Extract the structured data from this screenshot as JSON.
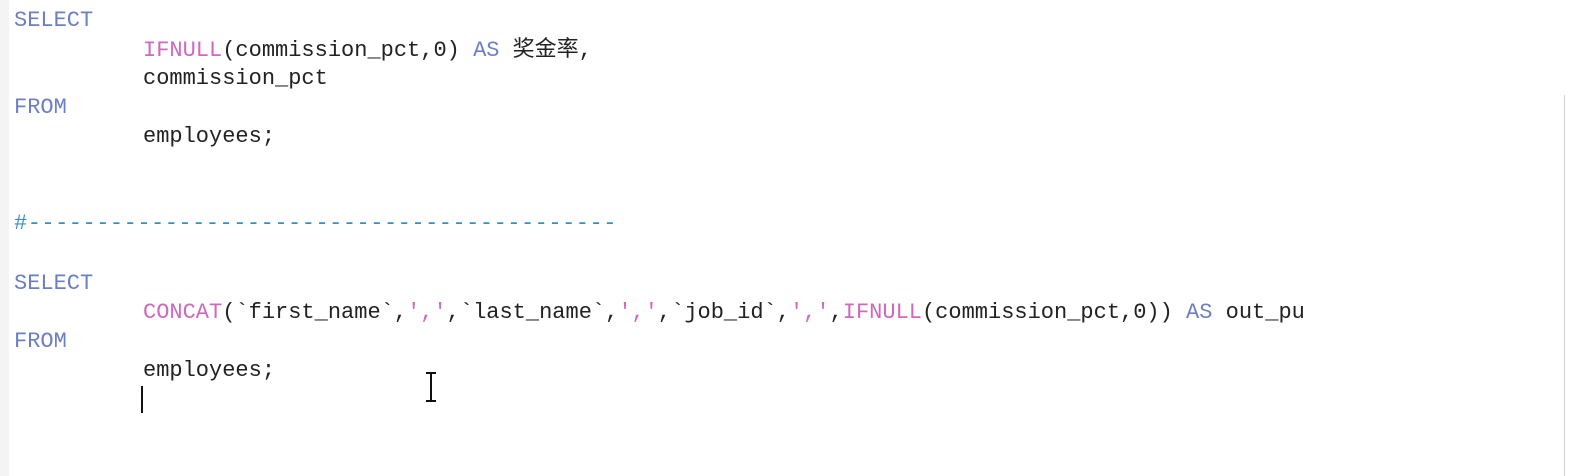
{
  "editor": {
    "lines": [
      {
        "tokens": [
          {
            "t": "SELECT",
            "c": "kw"
          }
        ]
      },
      {
        "indent": true,
        "tokens": [
          {
            "t": "IFNULL",
            "c": "fn"
          },
          {
            "t": "(commission_pct,0) ",
            "c": "id"
          },
          {
            "t": "AS",
            "c": "kw"
          },
          {
            "t": " ",
            "c": "id"
          },
          {
            "t": "奖金率",
            "c": "id cjk"
          },
          {
            "t": ",",
            "c": "id"
          }
        ]
      },
      {
        "indent": true,
        "tokens": [
          {
            "t": "commission_pct",
            "c": "id"
          }
        ]
      },
      {
        "tokens": [
          {
            "t": "FROM",
            "c": "kw"
          }
        ]
      },
      {
        "indent": true,
        "tokens": [
          {
            "t": "employees;",
            "c": "id"
          }
        ]
      },
      {
        "tokens": []
      },
      {
        "tokens": []
      },
      {
        "tokens": [
          {
            "t": "#-------------------------------------------",
            "c": "cm"
          }
        ]
      },
      {
        "tokens": []
      },
      {
        "tokens": [
          {
            "t": "SELECT",
            "c": "kw"
          }
        ]
      },
      {
        "indent": true,
        "tokens": [
          {
            "t": "CONCAT",
            "c": "fn"
          },
          {
            "t": "(`first_name`,",
            "c": "id"
          },
          {
            "t": "','",
            "c": "str"
          },
          {
            "t": ",`last_name`,",
            "c": "id"
          },
          {
            "t": "','",
            "c": "str"
          },
          {
            "t": ",`job_id`,",
            "c": "id"
          },
          {
            "t": "','",
            "c": "str"
          },
          {
            "t": ",",
            "c": "id"
          },
          {
            "t": "IFNULL",
            "c": "fn"
          },
          {
            "t": "(commission_pct,0)) ",
            "c": "id"
          },
          {
            "t": "AS",
            "c": "kw"
          },
          {
            "t": " out_pu",
            "c": "id"
          }
        ]
      },
      {
        "tokens": [
          {
            "t": "FROM",
            "c": "kw"
          }
        ]
      },
      {
        "indent": true,
        "tokens": [
          {
            "t": "employees;",
            "c": "id"
          }
        ]
      }
    ]
  }
}
